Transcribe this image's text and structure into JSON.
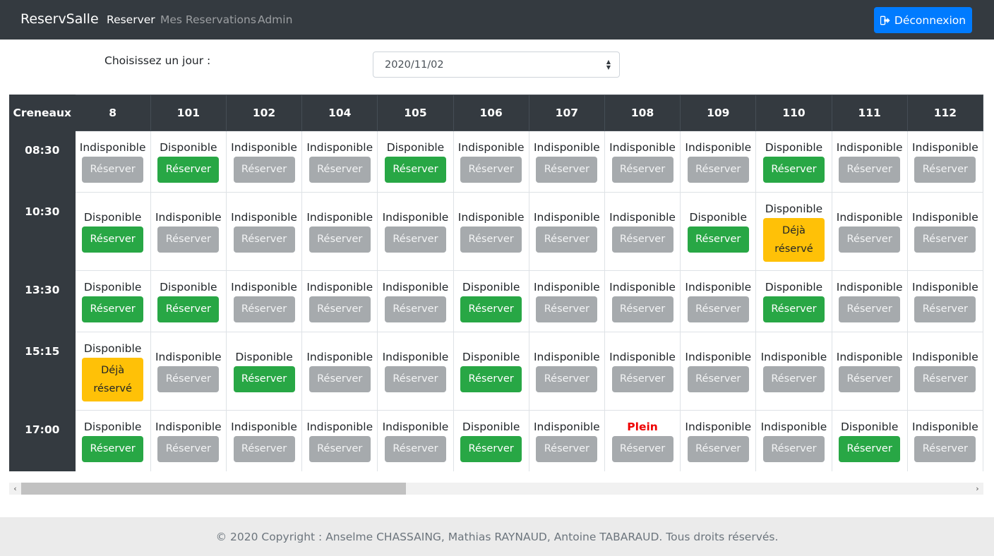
{
  "navbar": {
    "brand": "ReservSalle",
    "links": [
      "Reserver",
      "Mes Reservations",
      "Admin"
    ],
    "logout_label": "Déconnexion"
  },
  "day_picker": {
    "label": "Choisissez un jour :",
    "selected": "2020/11/02"
  },
  "table": {
    "corner_label": "Creneaux",
    "rooms": [
      "8",
      "101",
      "102",
      "104",
      "105",
      "106",
      "107",
      "108",
      "109",
      "110",
      "111",
      "112"
    ],
    "slots": [
      {
        "time": "08:30",
        "cells": [
          {
            "status": "Indisponible",
            "button": "Réserver",
            "state": "muted"
          },
          {
            "status": "Disponible",
            "button": "Réserver",
            "state": "success"
          },
          {
            "status": "Indisponible",
            "button": "Réserver",
            "state": "muted"
          },
          {
            "status": "Indisponible",
            "button": "Réserver",
            "state": "muted"
          },
          {
            "status": "Disponible",
            "button": "Réserver",
            "state": "success"
          },
          {
            "status": "Indisponible",
            "button": "Réserver",
            "state": "muted"
          },
          {
            "status": "Indisponible",
            "button": "Réserver",
            "state": "muted"
          },
          {
            "status": "Indisponible",
            "button": "Réserver",
            "state": "muted"
          },
          {
            "status": "Indisponible",
            "button": "Réserver",
            "state": "muted"
          },
          {
            "status": "Disponible",
            "button": "Réserver",
            "state": "success"
          },
          {
            "status": "Indisponible",
            "button": "Réserver",
            "state": "muted"
          },
          {
            "status": "Indisponible",
            "button": "Réserver",
            "state": "muted"
          }
        ]
      },
      {
        "time": "10:30",
        "cells": [
          {
            "status": "Disponible",
            "button": "Réserver",
            "state": "success"
          },
          {
            "status": "Indisponible",
            "button": "Réserver",
            "state": "muted"
          },
          {
            "status": "Indisponible",
            "button": "Réserver",
            "state": "muted"
          },
          {
            "status": "Indisponible",
            "button": "Réserver",
            "state": "muted"
          },
          {
            "status": "Indisponible",
            "button": "Réserver",
            "state": "muted"
          },
          {
            "status": "Indisponible",
            "button": "Réserver",
            "state": "muted"
          },
          {
            "status": "Indisponible",
            "button": "Réserver",
            "state": "muted"
          },
          {
            "status": "Indisponible",
            "button": "Réserver",
            "state": "muted"
          },
          {
            "status": "Disponible",
            "button": "Réserver",
            "state": "success"
          },
          {
            "status": "Disponible",
            "button": "Déjà réservé",
            "state": "warn"
          },
          {
            "status": "Indisponible",
            "button": "Réserver",
            "state": "muted"
          },
          {
            "status": "Indisponible",
            "button": "Réserver",
            "state": "muted"
          }
        ]
      },
      {
        "time": "13:30",
        "cells": [
          {
            "status": "Disponible",
            "button": "Réserver",
            "state": "success"
          },
          {
            "status": "Disponible",
            "button": "Réserver",
            "state": "success"
          },
          {
            "status": "Indisponible",
            "button": "Réserver",
            "state": "muted"
          },
          {
            "status": "Indisponible",
            "button": "Réserver",
            "state": "muted"
          },
          {
            "status": "Indisponible",
            "button": "Réserver",
            "state": "muted"
          },
          {
            "status": "Disponible",
            "button": "Réserver",
            "state": "success"
          },
          {
            "status": "Indisponible",
            "button": "Réserver",
            "state": "muted"
          },
          {
            "status": "Indisponible",
            "button": "Réserver",
            "state": "muted"
          },
          {
            "status": "Indisponible",
            "button": "Réserver",
            "state": "muted"
          },
          {
            "status": "Disponible",
            "button": "Réserver",
            "state": "success"
          },
          {
            "status": "Indisponible",
            "button": "Réserver",
            "state": "muted"
          },
          {
            "status": "Indisponible",
            "button": "Réserver",
            "state": "muted"
          }
        ]
      },
      {
        "time": "15:15",
        "cells": [
          {
            "status": "Disponible",
            "button": "Déjà réservé",
            "state": "warn"
          },
          {
            "status": "Indisponible",
            "button": "Réserver",
            "state": "muted"
          },
          {
            "status": "Disponible",
            "button": "Réserver",
            "state": "success"
          },
          {
            "status": "Indisponible",
            "button": "Réserver",
            "state": "muted"
          },
          {
            "status": "Indisponible",
            "button": "Réserver",
            "state": "muted"
          },
          {
            "status": "Disponible",
            "button": "Réserver",
            "state": "success"
          },
          {
            "status": "Indisponible",
            "button": "Réserver",
            "state": "muted"
          },
          {
            "status": "Indisponible",
            "button": "Réserver",
            "state": "muted"
          },
          {
            "status": "Indisponible",
            "button": "Réserver",
            "state": "muted"
          },
          {
            "status": "Indisponible",
            "button": "Réserver",
            "state": "muted"
          },
          {
            "status": "Indisponible",
            "button": "Réserver",
            "state": "muted"
          },
          {
            "status": "Indisponible",
            "button": "Réserver",
            "state": "muted"
          }
        ]
      },
      {
        "time": "17:00",
        "cells": [
          {
            "status": "Disponible",
            "button": "Réserver",
            "state": "success"
          },
          {
            "status": "Indisponible",
            "button": "Réserver",
            "state": "muted"
          },
          {
            "status": "Indisponible",
            "button": "Réserver",
            "state": "muted"
          },
          {
            "status": "Indisponible",
            "button": "Réserver",
            "state": "muted"
          },
          {
            "status": "Indisponible",
            "button": "Réserver",
            "state": "muted"
          },
          {
            "status": "Disponible",
            "button": "Réserver",
            "state": "success"
          },
          {
            "status": "Indisponible",
            "button": "Réserver",
            "state": "muted"
          },
          {
            "status": "Plein",
            "button": "Réserver",
            "state": "muted",
            "plein": true
          },
          {
            "status": "Indisponible",
            "button": "Réserver",
            "state": "muted"
          },
          {
            "status": "Indisponible",
            "button": "Réserver",
            "state": "muted"
          },
          {
            "status": "Disponible",
            "button": "Réserver",
            "state": "success"
          },
          {
            "status": "Indisponible",
            "button": "Réserver",
            "state": "muted"
          }
        ]
      }
    ]
  },
  "colors": {
    "navbar": "#343a40",
    "primary": "#007bff",
    "success": "#28a745",
    "warning": "#ffc107",
    "muted_button": "#a6aaad",
    "plein_text": "#e00000"
  },
  "footer": {
    "text": "© 2020 Copyright : Anselme CHASSAING, Mathias RAYNAUD, Antoine TABARAUD. Tous droits réservés."
  }
}
